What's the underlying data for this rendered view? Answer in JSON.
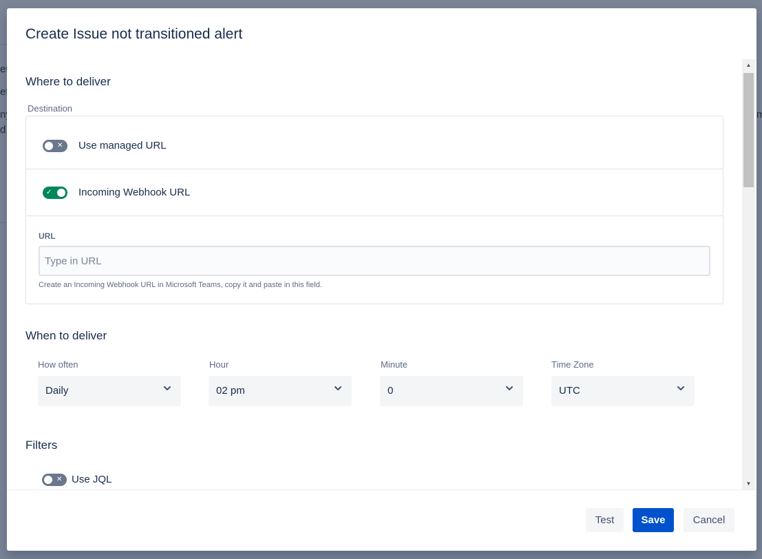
{
  "background": {
    "fragments": [
      "et",
      "et",
      "ny",
      "d",
      "m"
    ]
  },
  "modal": {
    "title": "Create Issue not transitioned alert"
  },
  "where": {
    "title": "Where to deliver",
    "destination_label": "Destination",
    "managed_url": {
      "label": "Use managed URL",
      "enabled": false
    },
    "webhook_url": {
      "label": "Incoming Webhook URL",
      "enabled": true
    },
    "url_label": "URL",
    "url_value": "",
    "url_placeholder": "Type in URL",
    "help": "Create an Incoming Webhook URL in Microsoft Teams, copy it and paste in this field."
  },
  "when": {
    "title": "When to deliver",
    "fields": [
      {
        "label": "How often",
        "value": "Daily"
      },
      {
        "label": "Hour",
        "value": "02 pm"
      },
      {
        "label": "Minute",
        "value": "0"
      },
      {
        "label": "Time Zone",
        "value": "UTC"
      }
    ]
  },
  "filters": {
    "title": "Filters",
    "jql": {
      "label": "Use JQL",
      "enabled": false
    }
  },
  "footer": {
    "test_label": "Test",
    "save_label": "Save",
    "cancel_label": "Cancel"
  },
  "colors": {
    "primary": "#0052cc",
    "toggle_on": "#00875a",
    "toggle_off": "#6b778c"
  }
}
